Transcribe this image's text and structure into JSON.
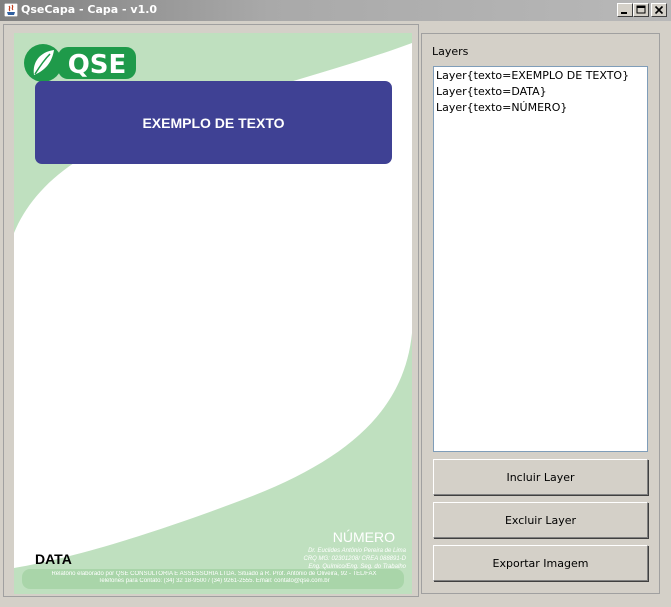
{
  "window": {
    "title": "QseCapa - Capa - v1.0"
  },
  "canvas": {
    "logo_text": "QSE",
    "banner_text": "EXEMPLO DE TEXTO",
    "numero_text": "NÚMERO",
    "data_text": "DATA",
    "author_lines": [
      "Dr. Euclides Antônio Pereira de Lima",
      "CRQ MG: 02301208/ CREA 088891-D",
      "Eng. Químico/Eng. Seg. do Trabalho"
    ],
    "footer_lines": [
      "Relatório elaborado por QSE CONSULTORIA E ASSESSORIA LTDA. Situado a R. Prof. Antônio de Oliveira, 92 - TEL/FAX",
      "Telefones para Contato: (34) 32 18-9500 / (34) 9261-2555. Email: contato@qse.com.br"
    ],
    "colors": {
      "banner": "#3f4194",
      "green_band": "#bfe0bf",
      "logo_green": "#1f9a4a"
    }
  },
  "layers_panel": {
    "title": "Layers",
    "items": [
      "Layer{texto=EXEMPLO DE TEXTO}",
      "Layer{texto=DATA}",
      "Layer{texto=NÚMERO}"
    ]
  },
  "buttons": {
    "include": "Incluir Layer",
    "exclude": "Excluir Layer",
    "export": "Exportar Imagem"
  }
}
